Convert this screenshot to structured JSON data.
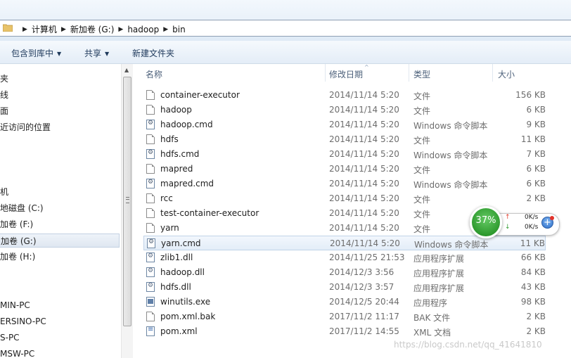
{
  "address": {
    "crumbs": [
      "计算机",
      "新加卷 (G:)",
      "hadoop",
      "bin"
    ]
  },
  "toolbar": {
    "include_label": "包含到库中",
    "share_label": "共享",
    "new_folder_label": "新建文件夹"
  },
  "nav": {
    "items": [
      "夹",
      "线",
      "面",
      "近访问的位置",
      "机",
      "地磁盘 (C:)",
      "加卷 (F:)",
      "加卷 (G:)",
      "加卷 (H:)",
      "MIN-PC",
      "ERSINO-PC",
      "S-PC",
      "MSW-PC"
    ],
    "selected": "加卷 (G:)"
  },
  "columns": {
    "name": "名称",
    "modified": "修改日期",
    "type": "类型",
    "size": "大小"
  },
  "files": [
    {
      "name": "container-executor",
      "date": "2014/11/14 5:20",
      "type": "文件",
      "size": "156 KB",
      "icon": "file-icon"
    },
    {
      "name": "hadoop",
      "date": "2014/11/14 5:20",
      "type": "文件",
      "size": "6 KB",
      "icon": "file-icon"
    },
    {
      "name": "hadoop.cmd",
      "date": "2014/11/14 5:20",
      "type": "Windows 命令脚本",
      "size": "9 KB",
      "icon": "cmd-script-icon"
    },
    {
      "name": "hdfs",
      "date": "2014/11/14 5:20",
      "type": "文件",
      "size": "11 KB",
      "icon": "file-icon"
    },
    {
      "name": "hdfs.cmd",
      "date": "2014/11/14 5:20",
      "type": "Windows 命令脚本",
      "size": "7 KB",
      "icon": "cmd-script-icon"
    },
    {
      "name": "mapred",
      "date": "2014/11/14 5:20",
      "type": "文件",
      "size": "6 KB",
      "icon": "file-icon"
    },
    {
      "name": "mapred.cmd",
      "date": "2014/11/14 5:20",
      "type": "Windows 命令脚本",
      "size": "6 KB",
      "icon": "cmd-script-icon"
    },
    {
      "name": "rcc",
      "date": "2014/11/14 5:20",
      "type": "文件",
      "size": "2 KB",
      "icon": "file-icon"
    },
    {
      "name": "test-container-executor",
      "date": "2014/11/14 5:20",
      "type": "文件",
      "size": "",
      "icon": "file-icon"
    },
    {
      "name": "yarn",
      "date": "2014/11/14 5:20",
      "type": "文件",
      "size": "",
      "icon": "file-icon"
    },
    {
      "name": "yarn.cmd",
      "date": "2014/11/14 5:20",
      "type": "Windows 命令脚本",
      "size": "11 KB",
      "icon": "cmd-script-icon",
      "selected": true
    },
    {
      "name": "zlib1.dll",
      "date": "2014/11/25 21:53",
      "type": "应用程序扩展",
      "size": "66 KB",
      "icon": "dll-icon"
    },
    {
      "name": "hadoop.dll",
      "date": "2014/12/3 3:56",
      "type": "应用程序扩展",
      "size": "84 KB",
      "icon": "dll-icon"
    },
    {
      "name": "hdfs.dll",
      "date": "2014/12/3 3:57",
      "type": "应用程序扩展",
      "size": "43 KB",
      "icon": "dll-icon"
    },
    {
      "name": "winutils.exe",
      "date": "2014/12/5 20:44",
      "type": "应用程序",
      "size": "98 KB",
      "icon": "exe-icon"
    },
    {
      "name": "pom.xml.bak",
      "date": "2017/11/2 11:17",
      "type": "BAK 文件",
      "size": "2 KB",
      "icon": "file-icon"
    },
    {
      "name": "pom.xml",
      "date": "2017/11/2 14:55",
      "type": "XML 文档",
      "size": "2 KB",
      "icon": "xml-icon"
    }
  ],
  "net_widget": {
    "percent": "37%",
    "up_speed": "0K/s",
    "down_speed": "0K/s",
    "plus": "+"
  },
  "watermark": "https://blog.csdn.net/qq_41641810"
}
